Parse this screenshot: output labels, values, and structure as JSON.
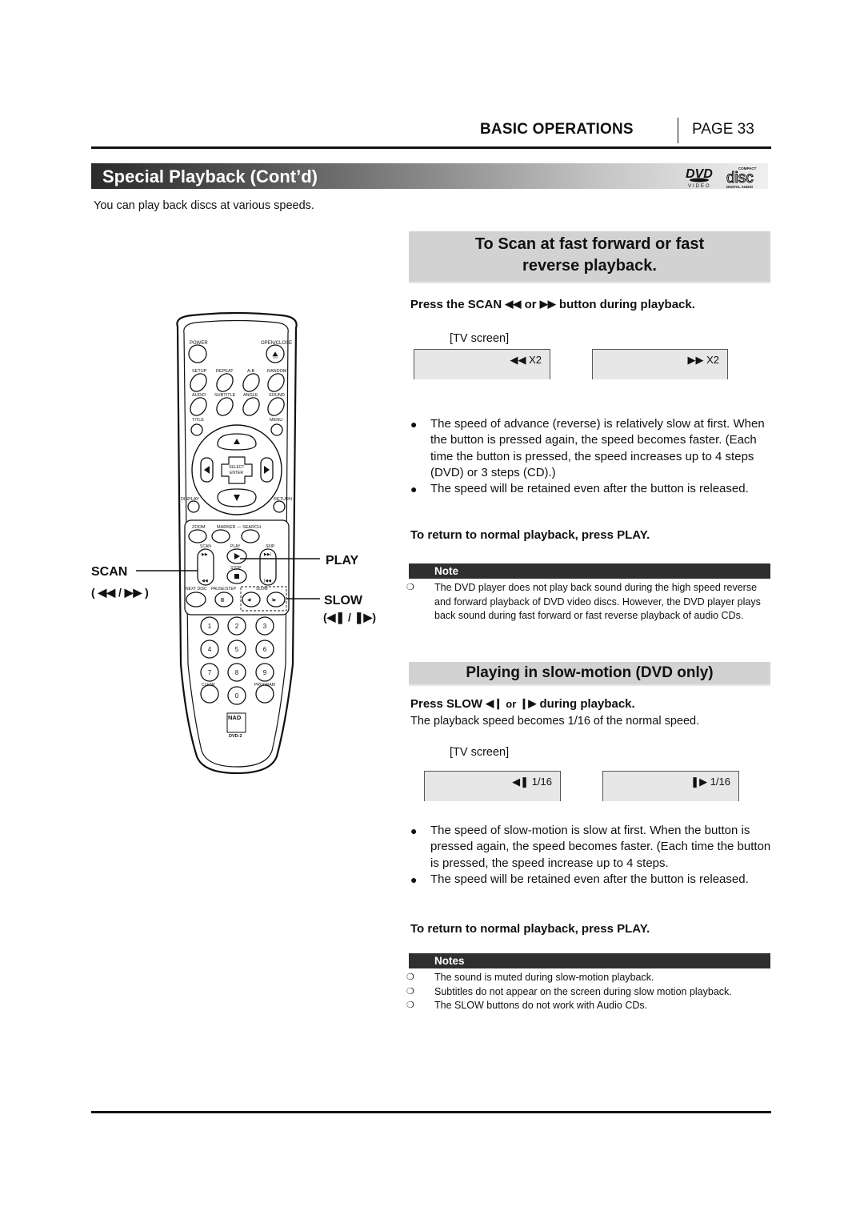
{
  "header": {
    "section": "BASIC OPERATIONS",
    "page": "PAGE 33"
  },
  "title_bar": {
    "title": "Special Playback (Cont’d)",
    "logos": [
      "dvd-video-logo",
      "compact-disc-digital-audio-logo"
    ],
    "logo_dvd_text": "VIDEO",
    "logo_cd_top": "COMPACT",
    "logo_cd_main": "disc",
    "logo_cd_bottom": "DIGITAL AUDIO"
  },
  "intro": "You can play back discs at various speeds.",
  "scan_section": {
    "heading_line1": "To Scan at fast forward or fast",
    "heading_line2": "reverse playback.",
    "instruction_prefix": "Press the SCAN",
    "instruction_or": "or",
    "instruction_suffix": "button during playback.",
    "rew_icon": "◀◀",
    "ff_icon": "▶▶",
    "tv_label": "[TV screen]",
    "tv_screens": [
      {
        "icon": "◀◀",
        "text": "X2"
      },
      {
        "icon": "▶▶",
        "text": "X2"
      }
    ],
    "bullets": [
      "The speed of advance (reverse) is relatively slow at first. When the button is pressed again, the speed becomes faster. (Each time the button is pressed, the speed increases up to 4 steps (DVD) or 3 steps (CD).)",
      "The speed will be retained even after the button is released."
    ],
    "return_instruction": "To return to normal playback, press PLAY.",
    "note_title": "Note",
    "notes": [
      "The DVD player does not play back sound during the high speed reverse and forward playback of DVD video discs. However, the DVD player plays back sound during fast forward or fast reverse playback of audio CDs."
    ]
  },
  "slow_section": {
    "heading": "Playing in slow-motion (DVD only)",
    "instruction_prefix": "Press SLOW",
    "instruction_or": "or",
    "instruction_suffix": "during playback.",
    "slow_rev_icon": "◀❙",
    "slow_fwd_icon": "❙▶",
    "description": "The playback speed becomes 1/16 of the normal speed.",
    "tv_label": "[TV screen]",
    "tv_screens": [
      {
        "icon": "◀❚",
        "text": "1/16"
      },
      {
        "icon": "❚▶",
        "text": "1/16"
      }
    ],
    "bullets": [
      "The speed of slow-motion is slow at first. When the button is pressed again, the speed becomes faster. (Each time the button is pressed, the speed increase up to 4 steps.",
      "The speed will be retained even after the button is released."
    ],
    "return_instruction": "To return to normal playback, press PLAY.",
    "note_title": "Notes",
    "notes": [
      "The sound is muted during slow-motion playback.",
      "Subtitles do not appear on the screen during slow motion playback.",
      "The SLOW buttons do not work with Audio CDs."
    ]
  },
  "remote": {
    "labels": {
      "power": "POWER",
      "open_close": "OPEN/CLOSE",
      "setup": "SETUP",
      "repeat": "REPEAT",
      "ab": "A-B",
      "random": "RANDOM",
      "audio": "AUDIO",
      "subtitle": "SUBTITLE",
      "angle": "ANGLE",
      "sound": "SOUND",
      "title": "TITLE",
      "menu": "MENU",
      "select1": "SELECT",
      "select2": "ENTER",
      "display": "DISPLAY",
      "return": "RETURN",
      "zoom": "ZOOM",
      "marker_search": "MARKER — SEARCH",
      "scan": "SCAN",
      "play": "PLAY",
      "skip": "SKIP",
      "stop": "STOP",
      "next_disc": "NEXT DISC",
      "pause_step": "PAUSE/STEP",
      "slow": "SLOW",
      "clear": "CLEAR",
      "program": "PROGRAM",
      "brand": "NAD",
      "model": "DVD-2"
    },
    "digits": [
      "1",
      "2",
      "3",
      "4",
      "5",
      "6",
      "7",
      "8",
      "9",
      "0"
    ],
    "callouts": {
      "scan": "SCAN",
      "scan_icons": "( ◀◀ / ▶▶ )",
      "play": "PLAY",
      "slow": "SLOW",
      "slow_icons": "(◀❚ / ❚▶)"
    }
  }
}
